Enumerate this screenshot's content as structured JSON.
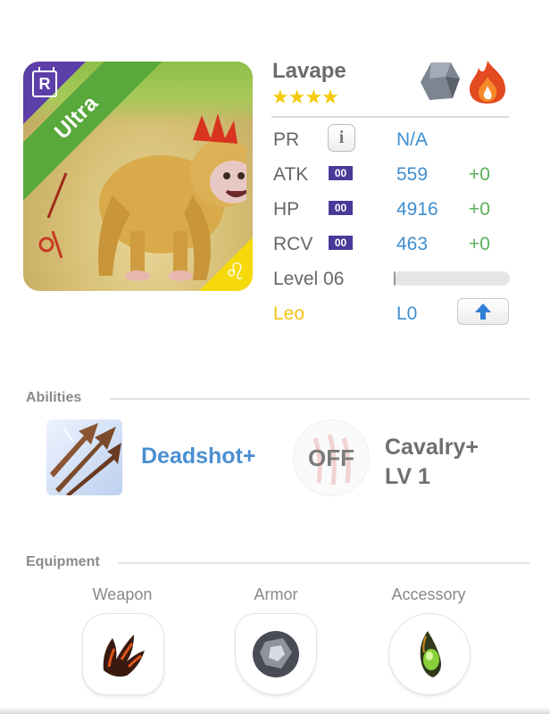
{
  "card": {
    "name": "Lavape",
    "stars": "★★★★",
    "rarity_label": "Ultra",
    "rarity_badge": "R",
    "zodiac_glyph": "♌",
    "elements": [
      "rock-element-icon",
      "fire-element-icon"
    ],
    "colors": {
      "rarity_band": "#58a83b",
      "rarity_corner": "#5c3fa8",
      "zodiac_corner": "#f5d90b",
      "stat_value": "#3f8fd0",
      "stat_bonus": "#5bb05b",
      "zodiac_text": "#f4c315"
    }
  },
  "stats": {
    "pr": {
      "label": "PR",
      "value": "N/A"
    },
    "atk": {
      "label": "ATK",
      "badge": "00",
      "value": "559",
      "bonus": "+0"
    },
    "hp": {
      "label": "HP",
      "badge": "00",
      "value": "4916",
      "bonus": "+0"
    },
    "rcv": {
      "label": "RCV",
      "badge": "00",
      "value": "463",
      "bonus": "+0"
    },
    "level": {
      "label": "Level 06",
      "progress": 0.01
    },
    "zodiac": {
      "label": "Leo",
      "level": "L0"
    }
  },
  "abilities": {
    "title": "Abilities",
    "primary": {
      "name": "Deadshot+",
      "icon": "triple-arrow-icon"
    },
    "secondary": {
      "state": "OFF",
      "name_line1": "Cavalry+",
      "name_line2": "LV 1",
      "icon": "claw-marks-icon"
    }
  },
  "equipment": {
    "title": "Equipment",
    "slots": [
      {
        "label": "Weapon",
        "icon": "lava-claw-icon"
      },
      {
        "label": "Armor",
        "icon": "stone-armor-icon"
      },
      {
        "label": "Accessory",
        "icon": "green-gem-icon"
      }
    ]
  }
}
